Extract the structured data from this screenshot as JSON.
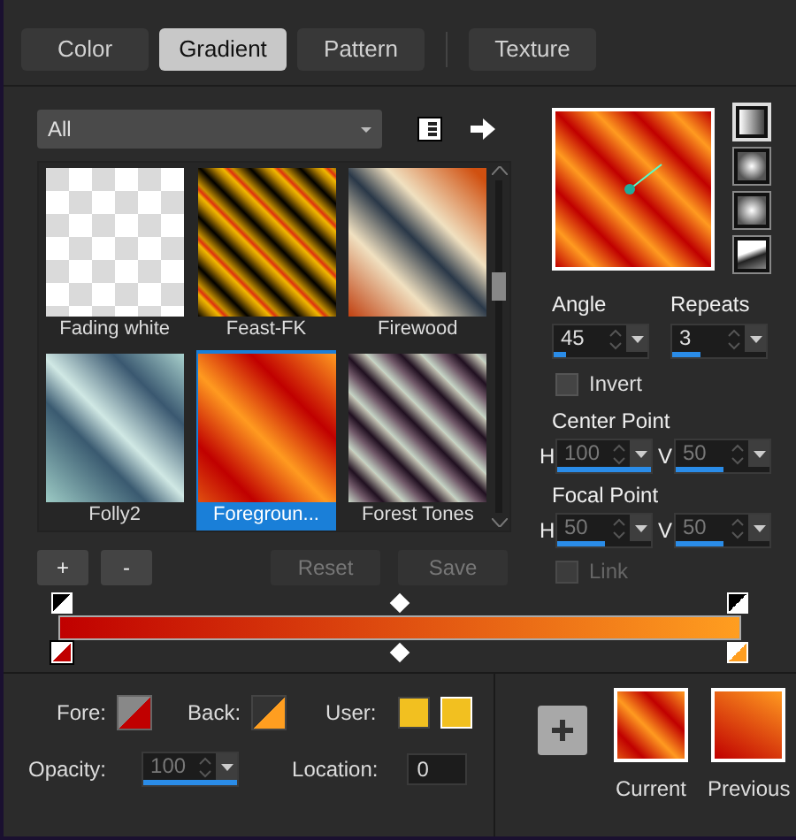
{
  "tabs": [
    {
      "label": "Color",
      "selected": false
    },
    {
      "label": "Gradient",
      "selected": true
    },
    {
      "label": "Pattern",
      "selected": false
    },
    {
      "label": "Texture",
      "selected": false
    }
  ],
  "category": {
    "value": "All"
  },
  "gradients": [
    {
      "name": "Fading white",
      "selected": false
    },
    {
      "name": "Feast-FK",
      "selected": false
    },
    {
      "name": "Firewood",
      "selected": false
    },
    {
      "name": "Folly2",
      "selected": false
    },
    {
      "name": "Foregroun...",
      "selected": true
    },
    {
      "name": "Forest Tones",
      "selected": false
    }
  ],
  "styles": [
    {
      "kind": "linear",
      "selected": true
    },
    {
      "kind": "rectangular",
      "selected": false
    },
    {
      "kind": "sunburst",
      "selected": false
    },
    {
      "kind": "radial",
      "selected": false
    }
  ],
  "angle": {
    "label": "Angle",
    "value": "45",
    "level": 0.125
  },
  "repeats": {
    "label": "Repeats",
    "value": "3",
    "level": 0.3
  },
  "invert": {
    "label": "Invert",
    "checked": false
  },
  "center_point": {
    "label": "Center Point",
    "h": {
      "label": "H",
      "value": "100",
      "level": 1,
      "disabled": true
    },
    "v": {
      "label": "V",
      "value": "50",
      "level": 0.5,
      "disabled": true
    }
  },
  "focal_point": {
    "label": "Focal Point",
    "h": {
      "label": "H",
      "value": "50",
      "level": 0.5,
      "disabled": true
    },
    "v": {
      "label": "V",
      "value": "50",
      "level": 0.5,
      "disabled": true
    }
  },
  "link": {
    "label": "Link",
    "checked": false,
    "disabled": true
  },
  "list_buttons": [
    {
      "label": "+",
      "disabled": false
    },
    {
      "label": "-",
      "disabled": false
    },
    {
      "label": "Reset",
      "disabled": true
    },
    {
      "label": "Save",
      "disabled": true
    }
  ],
  "color_stops": [
    {
      "color": "#c00000",
      "selected": true
    },
    {
      "color": "#ff9e20",
      "selected": false
    }
  ],
  "fore": {
    "label": "Fore:"
  },
  "back": {
    "label": "Back:"
  },
  "user": {
    "label": "User:"
  },
  "opacity": {
    "label": "Opacity:",
    "value": "100",
    "level": 1,
    "disabled": true
  },
  "location": {
    "label": "Location:",
    "value": "0"
  },
  "swatches": [
    {
      "label": "Current"
    },
    {
      "label": "Previous"
    }
  ]
}
